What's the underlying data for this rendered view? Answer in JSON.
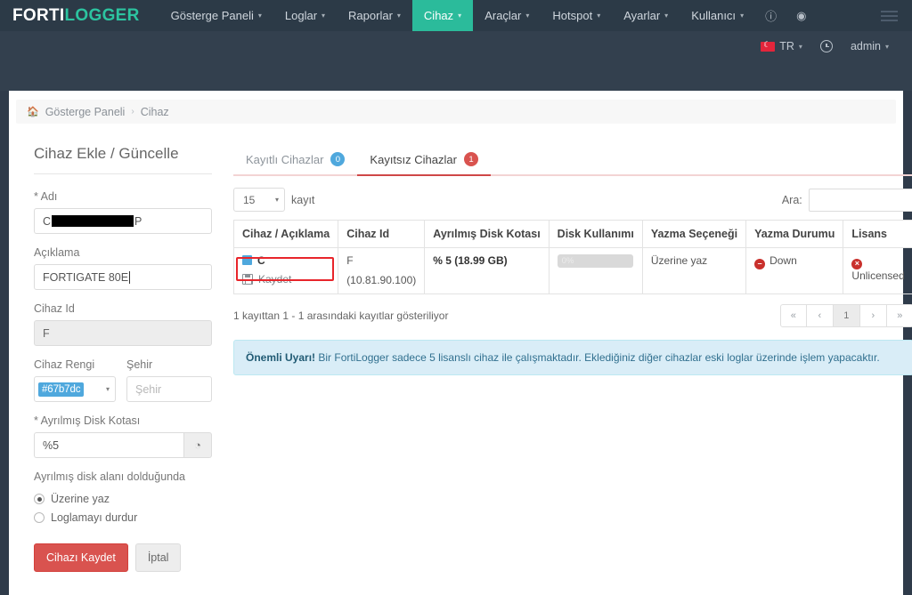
{
  "navbar": {
    "brand_first": "FORTI",
    "brand_second": "LOGGER",
    "items": [
      {
        "label": "Gösterge Paneli",
        "caret": "▾",
        "active": false
      },
      {
        "label": "Loglar",
        "caret": "▾",
        "active": false
      },
      {
        "label": "Raporlar",
        "caret": "▾",
        "active": false
      },
      {
        "label": "Cihaz",
        "caret": "▾",
        "active": true
      },
      {
        "label": "Araçlar",
        "caret": "▾",
        "active": false
      },
      {
        "label": "Hotspot",
        "caret": "▾",
        "active": false
      },
      {
        "label": "Ayarlar",
        "caret": "▾",
        "active": false
      },
      {
        "label": "Kullanıcı",
        "caret": "▾",
        "active": false
      }
    ],
    "info_icon": "ⓘ",
    "eye_icon": "◉"
  },
  "subbar": {
    "language": "TR",
    "language_caret": "▾",
    "user": "admin",
    "user_caret": "▾"
  },
  "breadcrumb": {
    "home": "Gösterge Paneli",
    "separator": "›",
    "current": "Cihaz"
  },
  "form": {
    "title": "Cihaz Ekle / Güncelle",
    "name_label": "* Adı",
    "name_value_prefix": "C",
    "name_value_suffix": "P",
    "description_label": "Açıklama",
    "description_value": "FORTIGATE 80E",
    "device_id_label": "Cihaz Id",
    "device_id_value": "F",
    "color_label": "Cihaz Rengi",
    "color_value": "#67b7dc",
    "color_caret": "▾",
    "city_label": "Şehir",
    "city_placeholder": "Şehir",
    "quota_label": "* Ayrılmış Disk Kotası",
    "quota_value": "%5",
    "quota_icon": "◔",
    "fullaction_label": "Ayrılmış disk alanı dolduğunda",
    "radio_overwrite": "Üzerine yaz",
    "radio_stoplog": "Loglamayı durdur",
    "save_button": "Cihazı Kaydet",
    "cancel_button": "İptal"
  },
  "tabs": [
    {
      "label": "Kayıtlı Cihazlar",
      "count": "0",
      "color": "blue",
      "active": false
    },
    {
      "label": "Kayıtsız Cihazlar",
      "count": "1",
      "color": "red",
      "active": true
    }
  ],
  "table_controls": {
    "page_length": "15",
    "page_length_caret": "▾",
    "records_label": "kayıt",
    "search_label": "Ara:",
    "search_value": ""
  },
  "table": {
    "headers": [
      "Cihaz / Açıklama",
      "Cihaz Id",
      "Ayrılmış Disk Kotası",
      "Disk Kullanımı",
      "Yazma Seçeneği",
      "Yazma Durumu",
      "Lisans"
    ],
    "rows": [
      {
        "device_name": "C",
        "device_color": "#4fa8dd",
        "save_label": "Kaydet",
        "device_id": "F",
        "device_ip": "(10.81.90.100)",
        "quota": "% 5 (18.99 GB)",
        "disk_usage": "0%",
        "disk_usage_percent": 0,
        "write_option": "Üzerine yaz",
        "write_status": "Down",
        "write_status_icon": "–",
        "license": "Unlicensed",
        "license_icon": "×"
      }
    ]
  },
  "table_footer": {
    "info": "1 kayıttan 1 - 1 arasındaki kayıtlar gösteriliyor",
    "pagination": [
      {
        "label": "«",
        "active": false
      },
      {
        "label": "‹",
        "active": false
      },
      {
        "label": "1",
        "active": true
      },
      {
        "label": "›",
        "active": false
      },
      {
        "label": "»",
        "active": false
      }
    ]
  },
  "alert": {
    "strong": "Önemli Uyarı!",
    "text": " Bir FortiLogger sadece 5 lisanslı cihaz ile çalışmaktadır. Eklediğiniz diğer cihazlar eski loglar üzerinde işlem yapacaktır."
  },
  "colors": {
    "brand_accent": "#2cc4a0",
    "nav_bg": "#2c3a47",
    "tab_active": "#cf4747",
    "danger": "#d9534f",
    "device_swatch": "#4fa8dd",
    "highlight_box": "#e8252b"
  }
}
